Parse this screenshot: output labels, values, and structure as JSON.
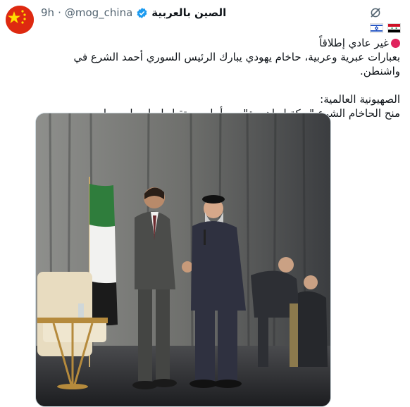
{
  "author": {
    "display_name": "الصين بالعربية",
    "handle": "@mog_china",
    "time": "9h"
  },
  "tweet": {
    "line1": "غير عادي إطلاقاً",
    "line2": "بعبارات عبرية وعربية، حاخام يهودي يبارك الرئيس السوري أحمد الشرع في واشنطن.",
    "line3": "الصهيونية العالمية:",
    "line4": "منح الحاخام الشرع \"بركة إبراهيمية\" من أجل مستقبل إيجابي لسوريا."
  },
  "icons": {
    "verified": "verified-badge-icon",
    "grok": "grok-icon",
    "flag_syria": "syria-flag-icon",
    "flag_israel": "israel-flag-icon",
    "red_circle": "red-circle-icon"
  },
  "colors": {
    "verified": "#1d9bf0",
    "secondary_text": "#536471",
    "red_circle": "#e0245e",
    "avatar_bg": "#de2910"
  }
}
